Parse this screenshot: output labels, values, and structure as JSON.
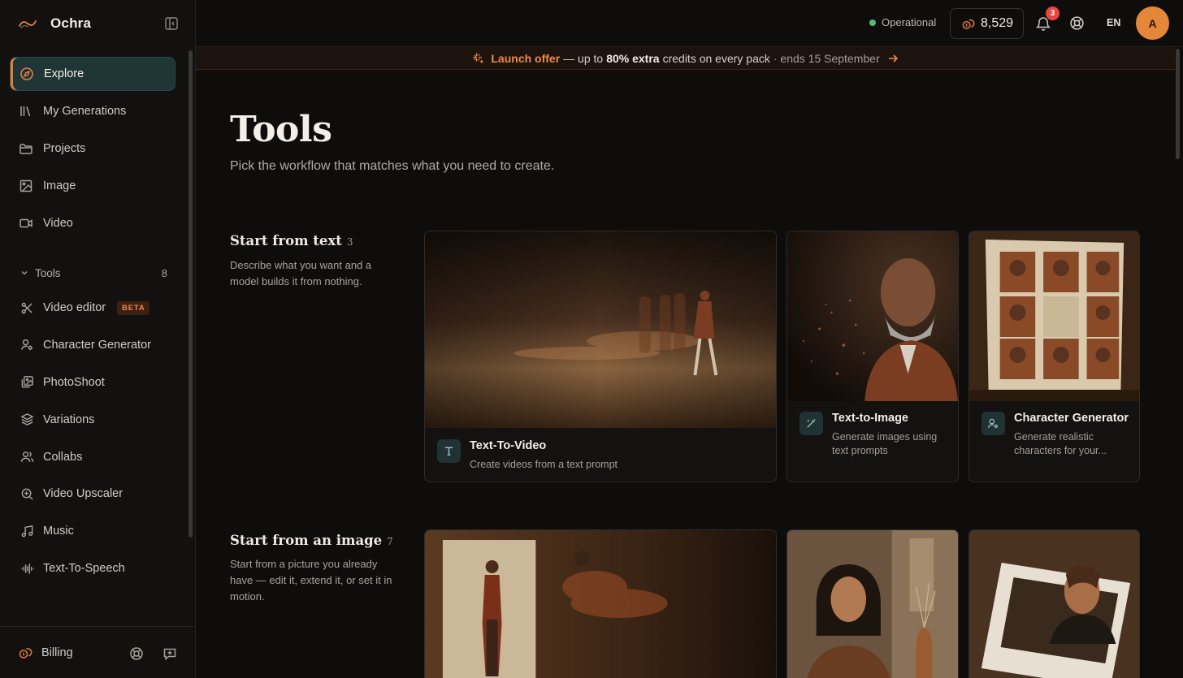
{
  "app": {
    "name": "Ochra"
  },
  "sidebar": {
    "nav": [
      {
        "label": "Explore",
        "icon": "compass-icon",
        "active": true
      },
      {
        "label": "My Generations",
        "icon": "library-icon"
      },
      {
        "label": "Projects",
        "icon": "folder-icon"
      },
      {
        "label": "Image",
        "icon": "image-icon"
      },
      {
        "label": "Video",
        "icon": "video-icon"
      }
    ],
    "tools_header": {
      "label": "Tools",
      "count": "8"
    },
    "tools": [
      {
        "label": "Video editor",
        "icon": "scissors-icon",
        "badge": "BETA"
      },
      {
        "label": "Character Generator",
        "icon": "user-cog-icon"
      },
      {
        "label": "PhotoShoot",
        "icon": "images-icon"
      },
      {
        "label": "Variations",
        "icon": "layers-icon"
      },
      {
        "label": "Collabs",
        "icon": "users-icon"
      },
      {
        "label": "Video Upscaler",
        "icon": "zoom-in-icon"
      },
      {
        "label": "Music",
        "icon": "music-icon"
      },
      {
        "label": "Text-To-Speech",
        "icon": "audio-waveform-icon"
      }
    ],
    "footer": {
      "billing_label": "Billing"
    }
  },
  "topbar": {
    "status": "Operational",
    "credits": "8,529",
    "notifications_count": "3",
    "language": "EN",
    "avatar_initial": "A"
  },
  "promo": {
    "offer": "Launch offer",
    "text_before": "— up to",
    "highlight": "80% extra",
    "text_after": "credits on every pack",
    "ends": "· ends 15 September"
  },
  "main": {
    "title": "Tools",
    "subtitle": "Pick the workflow that matches what you need to create.",
    "sections": [
      {
        "title": "Start from text",
        "count": "3",
        "description": "Describe what you want and a model builds it from nothing.",
        "cards": [
          {
            "title": "Text-To-Video",
            "description": "Create videos from a text prompt",
            "icon": "type-icon"
          },
          {
            "title": "Text-to-Image",
            "description": "Generate images using text prompts",
            "icon": "wand-icon"
          },
          {
            "title": "Character Generator",
            "description": "Generate realistic characters for your...",
            "icon": "user-cog-icon"
          }
        ]
      },
      {
        "title": "Start from an image",
        "count": "7",
        "description": "Start from a picture you already have — edit it, extend it, or set it in motion."
      }
    ]
  },
  "colors": {
    "accent": "#e07a3d",
    "active_bg": "#203536",
    "background": "#0e0d0c",
    "status_ok": "#56b87a",
    "badge_red": "#e8473f"
  }
}
